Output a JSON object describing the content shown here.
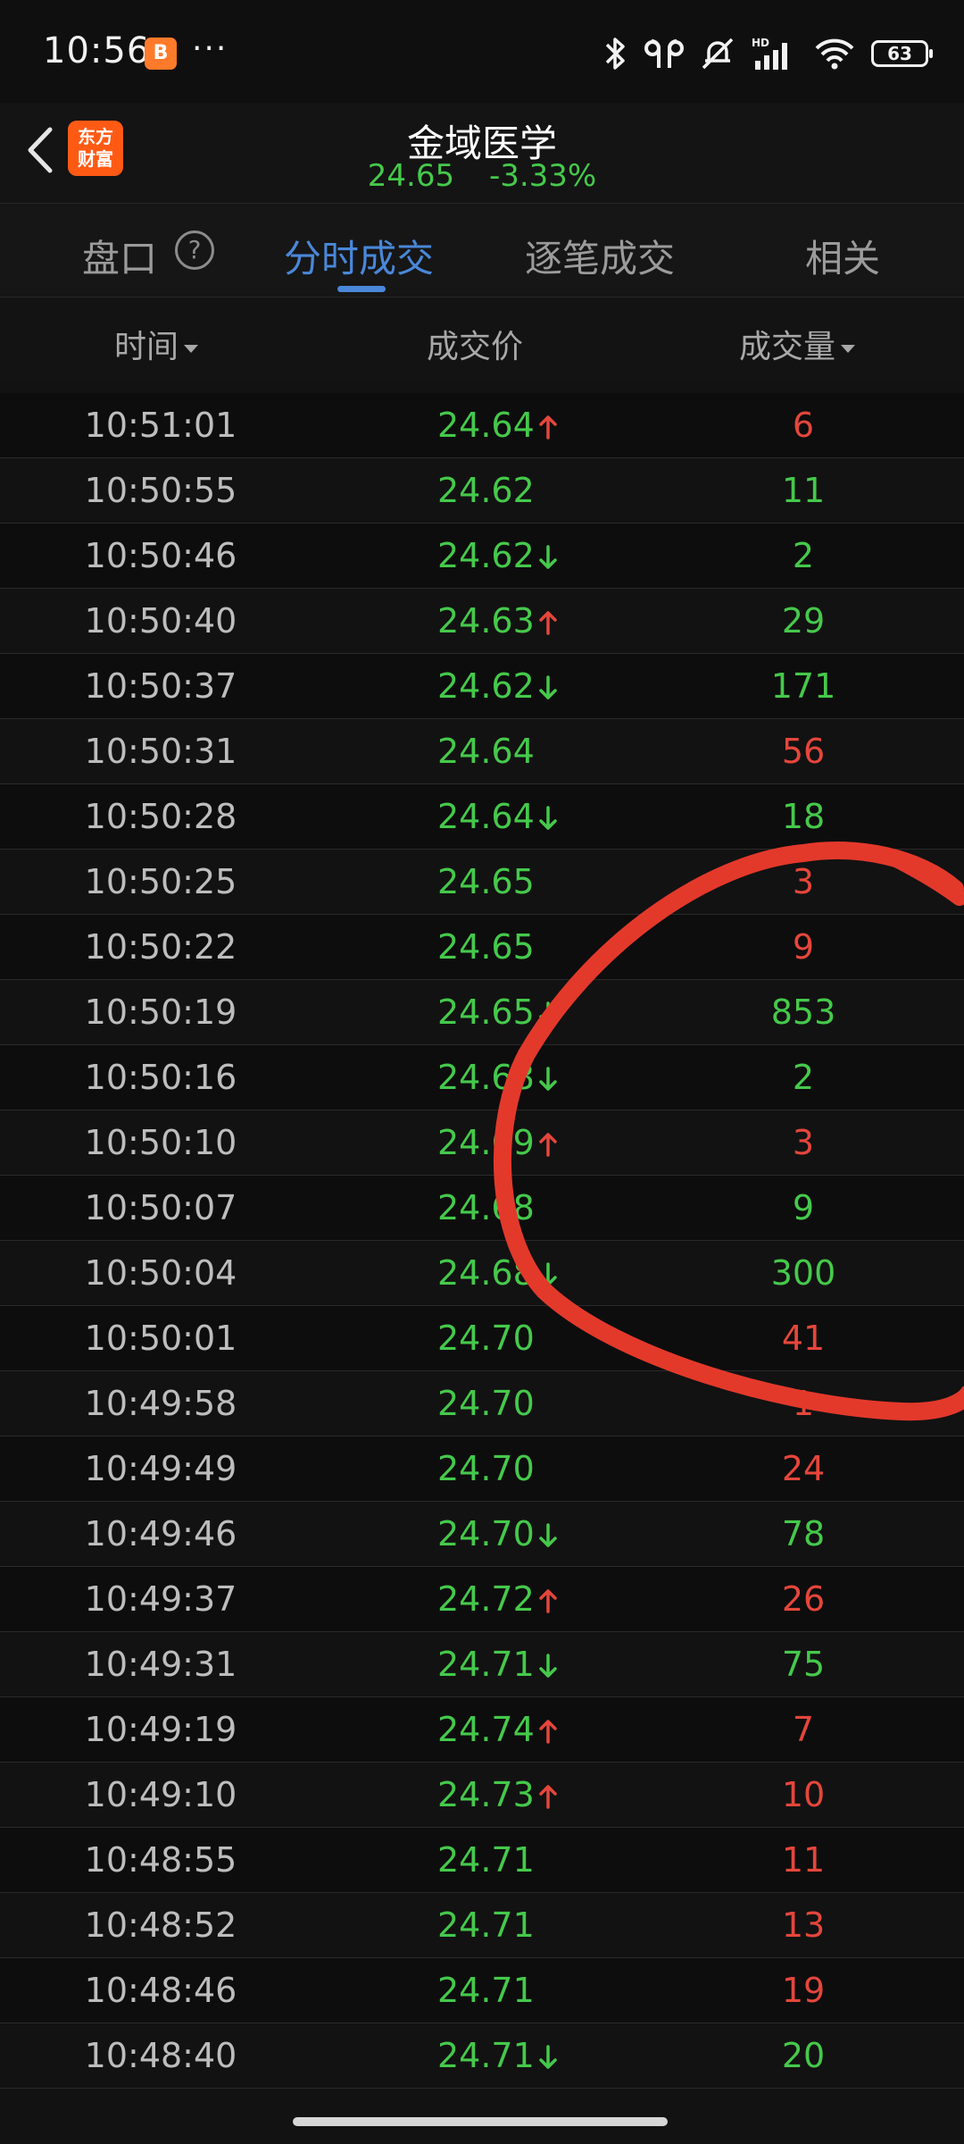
{
  "status_bar": {
    "time": "10:56",
    "app_badge": "B",
    "more": "···",
    "battery": "63"
  },
  "header": {
    "logo_line1": "东方",
    "logo_line2": "财富",
    "title": "金域医学",
    "price": "24.65",
    "change": "-3.33%"
  },
  "tabs": [
    {
      "label": "盘口"
    },
    {
      "label": "分时成交"
    },
    {
      "label": "逐笔成交"
    },
    {
      "label": "相关"
    }
  ],
  "help_glyph": "?",
  "columns": {
    "time": "时间",
    "price": "成交价",
    "volume": "成交量"
  },
  "colors": {
    "up": "#e5463b",
    "down": "#45c94b",
    "accent": "#4a87d9",
    "annotation": "#e3392b"
  },
  "trades": [
    {
      "time": "10:51:01",
      "price": "24.64",
      "arrow": "up",
      "volume": "6",
      "vcolor": "red"
    },
    {
      "time": "10:50:55",
      "price": "24.62",
      "arrow": "",
      "volume": "11",
      "vcolor": "green"
    },
    {
      "time": "10:50:46",
      "price": "24.62",
      "arrow": "down",
      "volume": "2",
      "vcolor": "green"
    },
    {
      "time": "10:50:40",
      "price": "24.63",
      "arrow": "up",
      "volume": "29",
      "vcolor": "green"
    },
    {
      "time": "10:50:37",
      "price": "24.62",
      "arrow": "down",
      "volume": "171",
      "vcolor": "green"
    },
    {
      "time": "10:50:31",
      "price": "24.64",
      "arrow": "",
      "volume": "56",
      "vcolor": "red"
    },
    {
      "time": "10:50:28",
      "price": "24.64",
      "arrow": "down",
      "volume": "18",
      "vcolor": "green"
    },
    {
      "time": "10:50:25",
      "price": "24.65",
      "arrow": "",
      "volume": "3",
      "vcolor": "red"
    },
    {
      "time": "10:50:22",
      "price": "24.65",
      "arrow": "",
      "volume": "9",
      "vcolor": "red"
    },
    {
      "time": "10:50:19",
      "price": "24.65",
      "arrow": "down",
      "volume": "853",
      "vcolor": "green"
    },
    {
      "time": "10:50:16",
      "price": "24.68",
      "arrow": "down",
      "volume": "2",
      "vcolor": "green"
    },
    {
      "time": "10:50:10",
      "price": "24.69",
      "arrow": "up",
      "volume": "3",
      "vcolor": "red"
    },
    {
      "time": "10:50:07",
      "price": "24.68",
      "arrow": "",
      "volume": "9",
      "vcolor": "green"
    },
    {
      "time": "10:50:04",
      "price": "24.68",
      "arrow": "down",
      "volume": "300",
      "vcolor": "green"
    },
    {
      "time": "10:50:01",
      "price": "24.70",
      "arrow": "",
      "volume": "41",
      "vcolor": "red"
    },
    {
      "time": "10:49:58",
      "price": "24.70",
      "arrow": "",
      "volume": "1",
      "vcolor": "red"
    },
    {
      "time": "10:49:49",
      "price": "24.70",
      "arrow": "",
      "volume": "24",
      "vcolor": "red"
    },
    {
      "time": "10:49:46",
      "price": "24.70",
      "arrow": "down",
      "volume": "78",
      "vcolor": "green"
    },
    {
      "time": "10:49:37",
      "price": "24.72",
      "arrow": "up",
      "volume": "26",
      "vcolor": "red"
    },
    {
      "time": "10:49:31",
      "price": "24.71",
      "arrow": "down",
      "volume": "75",
      "vcolor": "green"
    },
    {
      "time": "10:49:19",
      "price": "24.74",
      "arrow": "up",
      "volume": "7",
      "vcolor": "red"
    },
    {
      "time": "10:49:10",
      "price": "24.73",
      "arrow": "up",
      "volume": "10",
      "vcolor": "red"
    },
    {
      "time": "10:48:55",
      "price": "24.71",
      "arrow": "",
      "volume": "11",
      "vcolor": "red"
    },
    {
      "time": "10:48:52",
      "price": "24.71",
      "arrow": "",
      "volume": "13",
      "vcolor": "red"
    },
    {
      "time": "10:48:46",
      "price": "24.71",
      "arrow": "",
      "volume": "19",
      "vcolor": "red"
    },
    {
      "time": "10:48:40",
      "price": "24.71",
      "arrow": "down",
      "volume": "20",
      "vcolor": "green"
    }
  ]
}
